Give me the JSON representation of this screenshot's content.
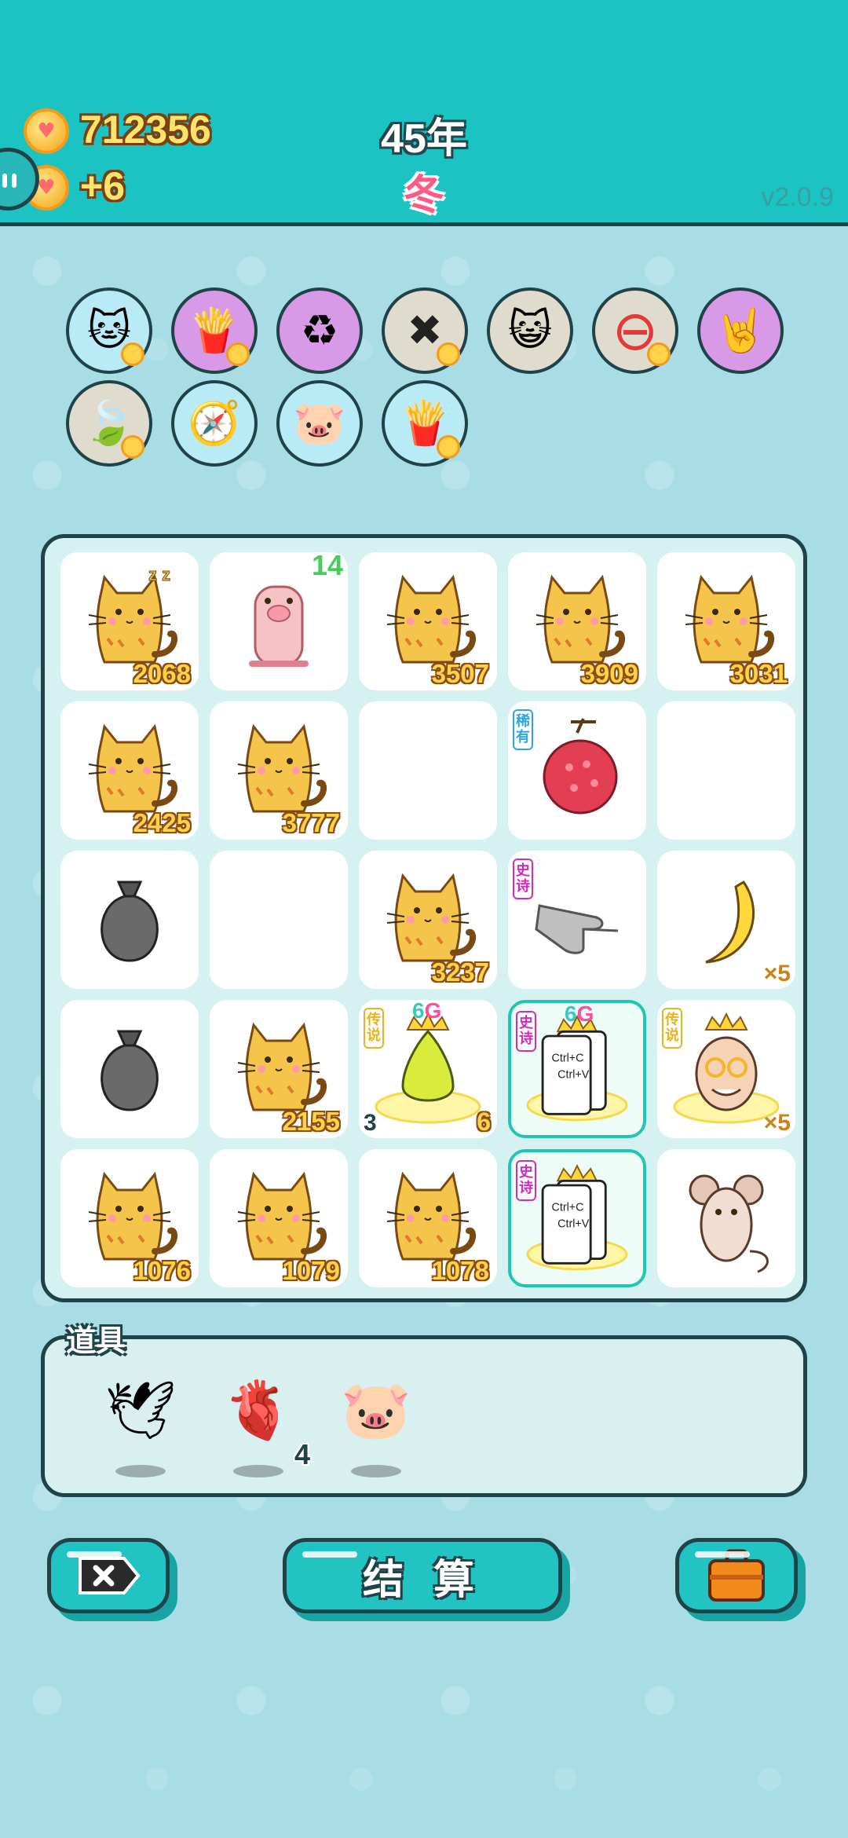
{
  "status": {
    "coins": "712356",
    "income": "+6",
    "year": "45年",
    "season": "冬",
    "version": "v2.0.9"
  },
  "abilities": [
    {
      "icon": "cat-icon",
      "bg": "#b9ebf6"
    },
    {
      "icon": "fries-icon",
      "bg": "#d899e6"
    },
    {
      "icon": "recycle-icon",
      "bg": "#d899e6"
    },
    {
      "icon": "remove-tag-icon",
      "bg": "#e0dccd"
    },
    {
      "icon": "cats-pair-icon",
      "bg": "#e0dccd"
    },
    {
      "icon": "minus-circle-icon",
      "bg": "#e0dccd"
    },
    {
      "icon": "rock-hand-icon",
      "bg": "#d899e6"
    },
    {
      "icon": "leaf-icon",
      "bg": "#e0dccd"
    },
    {
      "icon": "compass-icon",
      "bg": "#b9ebf6"
    },
    {
      "icon": "piggy-bank-icon",
      "bg": "#b9ebf6"
    },
    {
      "icon": "fries-icon",
      "bg": "#b9ebf6"
    }
  ],
  "grid": [
    {
      "type": "cat",
      "number": "2068",
      "sleeping": true
    },
    {
      "type": "pig",
      "top_number": "14"
    },
    {
      "type": "cat",
      "number": "3507"
    },
    {
      "type": "cat",
      "number": "3909"
    },
    {
      "type": "cat",
      "number": "3031"
    },
    {
      "type": "cat",
      "number": "2425"
    },
    {
      "type": "cat",
      "number": "3777"
    },
    {
      "type": "empty"
    },
    {
      "type": "lychee",
      "rarity": "稀有",
      "rarity_color": "blue"
    },
    {
      "type": "empty"
    },
    {
      "type": "trash-bag"
    },
    {
      "type": "empty"
    },
    {
      "type": "cat",
      "number": "3237"
    },
    {
      "type": "pointing-hand",
      "rarity": "史诗",
      "rarity_color": "pink"
    },
    {
      "type": "banana",
      "mult": "×5"
    },
    {
      "type": "trash-bag"
    },
    {
      "type": "cat",
      "number": "2155"
    },
    {
      "type": "crowned-pear",
      "rarity": "传说",
      "rarity_color": "gold",
      "g_tag_num": "6",
      "g_tag_letter": "G",
      "left_number": "3",
      "right_number": "6"
    },
    {
      "type": "ctrl-cv-card",
      "rarity": "史诗",
      "rarity_color": "pink",
      "g_tag_num": "6",
      "g_tag_letter": "G",
      "card_line1": "Ctrl+C",
      "card_line2": "Ctrl+V",
      "glow": true
    },
    {
      "type": "crowned-grandpa",
      "rarity": "传说",
      "rarity_color": "gold",
      "mult": "×5"
    },
    {
      "type": "cat",
      "number": "1076"
    },
    {
      "type": "cat",
      "number": "1079"
    },
    {
      "type": "cat",
      "number": "1078"
    },
    {
      "type": "ctrl-cv-card",
      "rarity": "史诗",
      "rarity_color": "pink",
      "card_line1": "Ctrl+C",
      "card_line2": "Ctrl+V",
      "glow": true
    },
    {
      "type": "mouse"
    }
  ],
  "items": {
    "label": "道具",
    "list": [
      {
        "icon": "bird-icon"
      },
      {
        "icon": "liver-icon",
        "count": "4"
      },
      {
        "icon": "piggy-bank-icon"
      }
    ]
  },
  "buttons": {
    "settle": "结 算"
  }
}
